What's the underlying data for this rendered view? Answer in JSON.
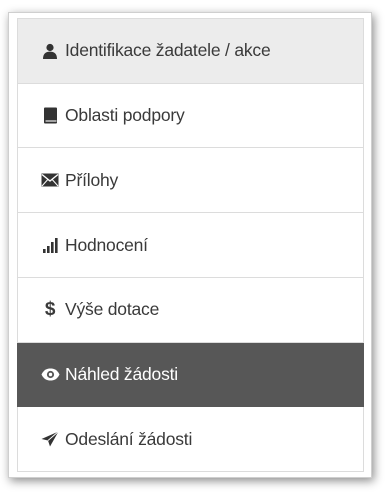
{
  "menu": {
    "items": [
      {
        "label": "Identifikace žadatele / akce",
        "icon": "user-icon",
        "active": false
      },
      {
        "label": "Oblasti podpory",
        "icon": "book-icon",
        "active": false
      },
      {
        "label": "Přílohy",
        "icon": "envelope-icon",
        "active": false
      },
      {
        "label": "Hodnocení",
        "icon": "signal-bars-icon",
        "active": false
      },
      {
        "label": "Výše dotace",
        "icon": "dollar-icon",
        "icon_text": "$",
        "active": false
      },
      {
        "label": "Náhled žádosti",
        "icon": "eye-icon",
        "active": true
      },
      {
        "label": "Odeslání žádosti",
        "icon": "send-icon",
        "active": false
      }
    ]
  },
  "colors": {
    "active_background": "#575757",
    "first_item_background": "#ececec",
    "text": "#3a3a3a"
  }
}
